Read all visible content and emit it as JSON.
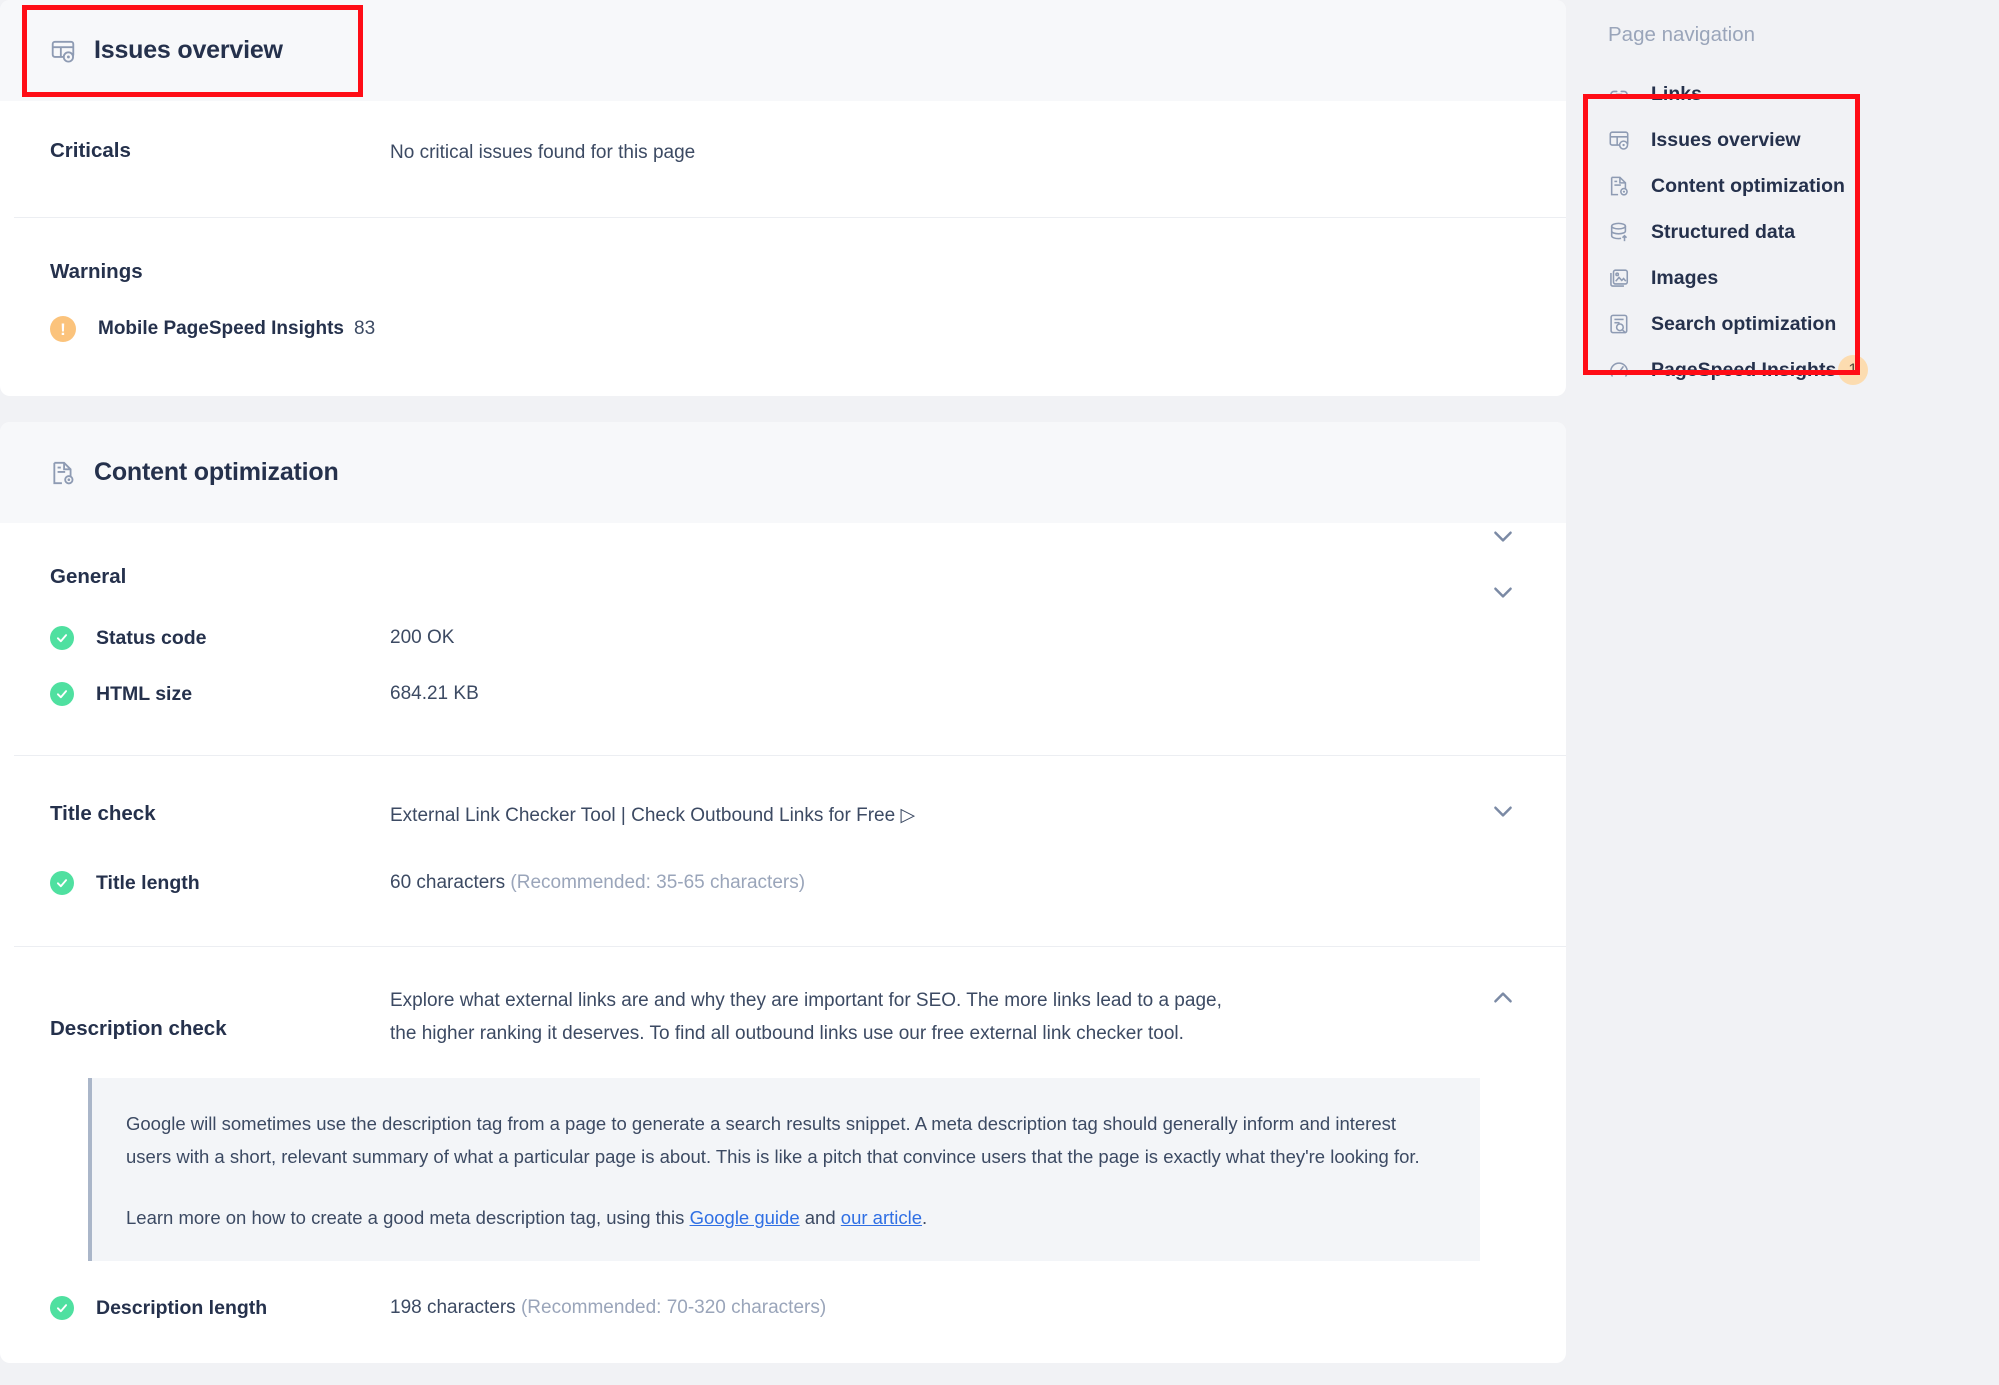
{
  "issues_card": {
    "header_title": "Issues overview",
    "header_icon": "issues-overview-icon",
    "criticals_label": "Criticals",
    "criticals_value": "No critical issues found for this page",
    "warnings_label": "Warnings",
    "warning_items": [
      {
        "icon": "warning-exclamation-icon",
        "name": "Mobile PageSpeed Insights",
        "value": "83"
      }
    ]
  },
  "content_card": {
    "header_title": "Content optimization",
    "header_icon": "content-optimization-icon",
    "general": {
      "heading": "General",
      "rows": [
        {
          "status_icon": "check-circle-icon",
          "label": "Status code",
          "value": "200 OK",
          "value_style": "green",
          "chevron": "chevron-down-icon"
        },
        {
          "status_icon": "check-circle-icon",
          "label": "HTML size",
          "value": "684.21 KB",
          "value_style": "normal",
          "chevron": "chevron-down-icon"
        }
      ]
    },
    "title_check": {
      "label": "Title check",
      "value": "External Link Checker Tool | Check Outbound Links for Free ▷",
      "chevron": "chevron-down-icon",
      "length_row": {
        "status_icon": "check-circle-icon",
        "label": "Title length",
        "value": "60 characters",
        "hint": "(Recommended: 35-65 characters)"
      }
    },
    "description_check": {
      "label": "Description check",
      "value": "Explore what external links are and why they are important for SEO. The more links lead to a page, the higher ranking it deserves. To find all outbound links use our free external link checker tool.",
      "chevron": "chevron-up-icon",
      "note_paragraph_1": "Google will sometimes use the description tag from a page to generate a search results snippet. A meta description tag should generally inform and interest users with a short, relevant summary of what a particular page is about. This is like a pitch that convince users that the page is exactly what they're looking for.",
      "note_learn_prefix": "Learn more on how to create a good meta description tag, using this ",
      "note_link_1": "Google guide",
      "note_mid": " and ",
      "note_link_2": "our article",
      "note_suffix": ".",
      "length_row": {
        "status_icon": "check-circle-icon",
        "label": "Description length",
        "value": "198 characters",
        "hint": "(Recommended: 70-320 characters)"
      }
    }
  },
  "page_navigation": {
    "title": "Page navigation",
    "items": [
      {
        "icon": "link-chain-icon",
        "label": "Links",
        "count": ""
      },
      {
        "icon": "issues-overview-icon",
        "label": "Issues overview",
        "count": ""
      },
      {
        "icon": "content-optimization-icon",
        "label": "Content optimization",
        "count": ""
      },
      {
        "icon": "structured-data-icon",
        "label": "Structured data",
        "count": ""
      },
      {
        "icon": "images-icon",
        "label": "Images",
        "count": ""
      },
      {
        "icon": "search-optimization-icon",
        "label": "Search optimization",
        "count": ""
      },
      {
        "icon": "pagespeed-gauge-icon",
        "label": "PageSpeed Insights",
        "count": "1"
      }
    ]
  },
  "colors": {
    "accent_green": "#4fd399",
    "warning_orange": "#fbc37c",
    "link_blue": "#2f6fe4",
    "text_dark": "#25314c",
    "annotation_red": "#ff0d16",
    "page_bg": "#f1f2f5"
  }
}
